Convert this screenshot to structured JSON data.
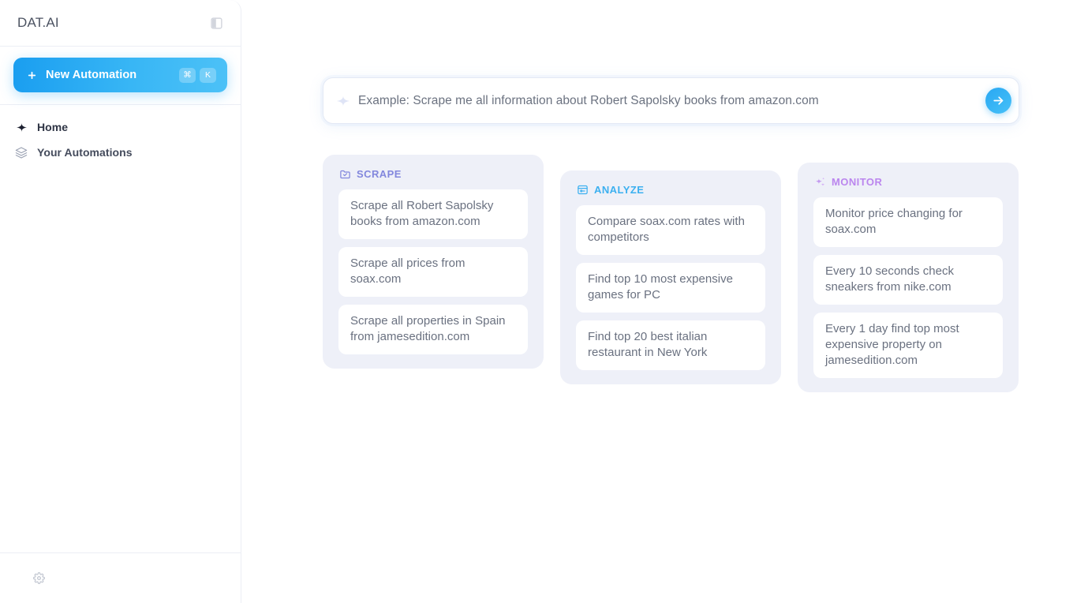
{
  "app": {
    "brand": "DAT.AI",
    "accent_blue": "#38b6f5",
    "accent_purple": "#8287dd",
    "accent_cyan": "#3cb0f0",
    "accent_violet": "#bb86ee",
    "card_bg": "#eef0f8",
    "page_bg": "#ffffff"
  },
  "sidebar": {
    "logo": "DAT.AI",
    "toggle_icon": "panel-left-icon",
    "new_automation": {
      "label": "New Automation",
      "plus_icon": "plus-icon",
      "shortcut_keys": [
        "⌘",
        "K"
      ]
    },
    "items": [
      {
        "label": "Home",
        "icon": "sparkle-icon"
      },
      {
        "label": "Your Automations",
        "icon": "layers-icon"
      }
    ],
    "footer": {
      "settings_icon": "gear-icon"
    }
  },
  "prompt": {
    "spark_icon": "sparkle-icon",
    "value": "",
    "placeholder": "Example: Scrape me all information about Robert Sapolsky books from amazon.com",
    "send_icon": "arrow-right-icon"
  },
  "suggestions": [
    {
      "key": "scrape",
      "title": "SCRAPE",
      "icon": "folder-check-icon",
      "items": [
        "Scrape all Robert Sapolsky books from amazon.com",
        "Scrape all prices from soax.com",
        "Scrape all properties in Spain from jamesedition.com"
      ]
    },
    {
      "key": "analyze",
      "title": "ANALYZE",
      "icon": "browser-window-icon",
      "items": [
        "Compare soax.com rates with competitors",
        "Find top 10 most expensive games for PC",
        "Find top 20 best italian restaurant in New York"
      ]
    },
    {
      "key": "monitor",
      "title": "MONITOR",
      "icon": "sparkles-icon",
      "items": [
        "Monitor price changing for soax.com",
        "Every 10 seconds check sneakers from nike.com",
        "Every 1 day find top most expensive property on jamesedition.com"
      ]
    }
  ]
}
